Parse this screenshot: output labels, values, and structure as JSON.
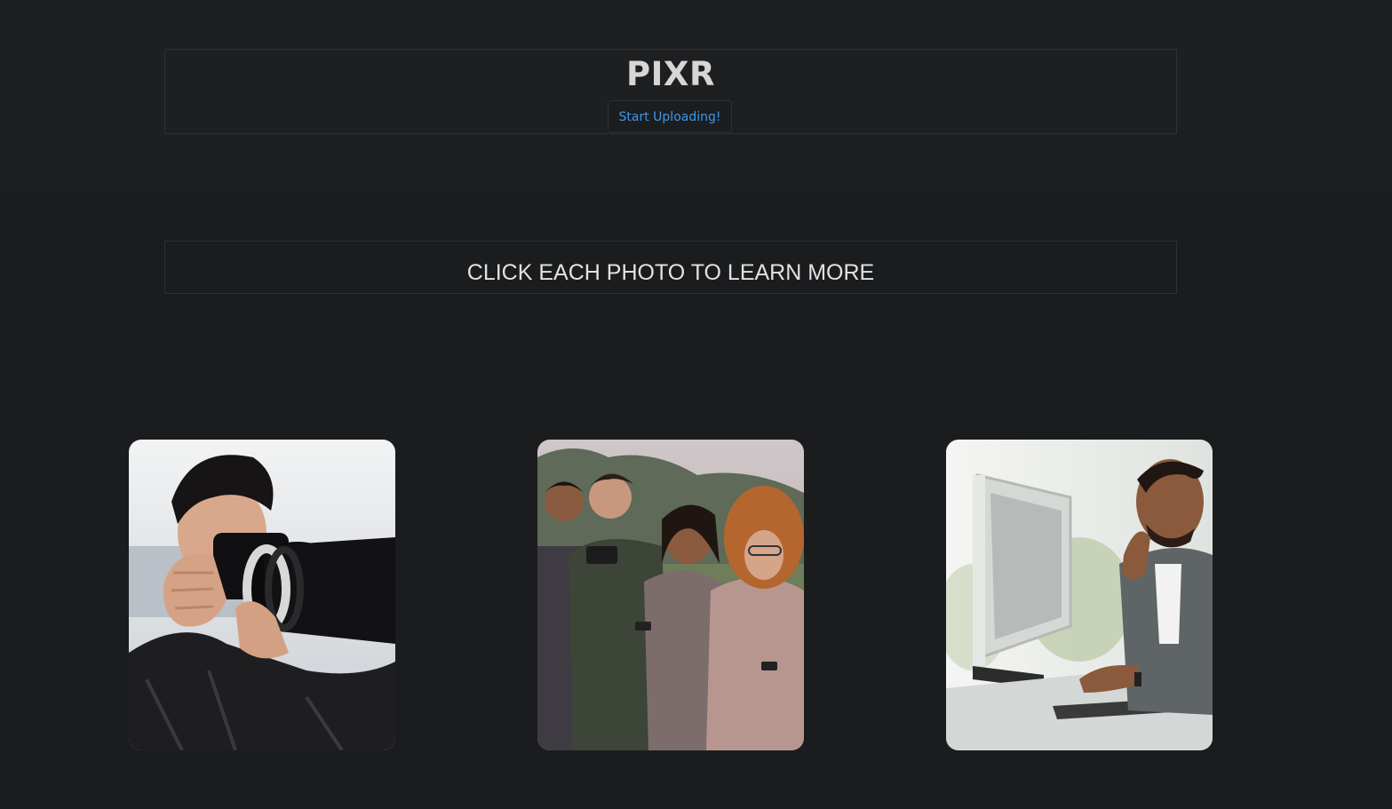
{
  "header": {
    "brand": "PIXR",
    "upload_label": "Start Uploading!"
  },
  "banner": {
    "text": "CLICK EACH PHOTO TO LEARN MORE"
  },
  "gallery": {
    "photos": [
      {
        "subject": "photographer with camera"
      },
      {
        "subject": "group of friends looking at phones"
      },
      {
        "subject": "man thinking at computer desk"
      }
    ]
  },
  "colors": {
    "background": "#1b1c1e",
    "header_background": "#1e1f21",
    "link_blue": "#3d97e8",
    "text_light": "#d6d6d6"
  }
}
